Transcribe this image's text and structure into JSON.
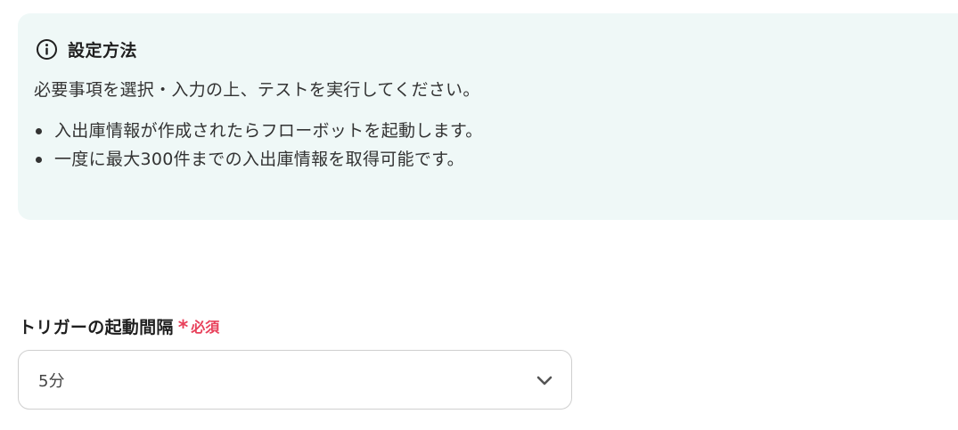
{
  "info": {
    "title": "設定方法",
    "icon": "info-circle-icon",
    "description": "必要事項を選択・入力の上、テストを実行してください。",
    "items": [
      "入出庫情報が作成されたらフローボットを起動します。",
      "一度に最大300件までの入出庫情報を取得可能です。"
    ],
    "background_color": "#eff8f7"
  },
  "trigger_interval": {
    "label": "トリガーの起動間隔",
    "required_mark": "*",
    "required_text": "必須",
    "required_color": "#e8405a",
    "selected_value": "5分",
    "dropdown_icon": "chevron-down-icon"
  }
}
